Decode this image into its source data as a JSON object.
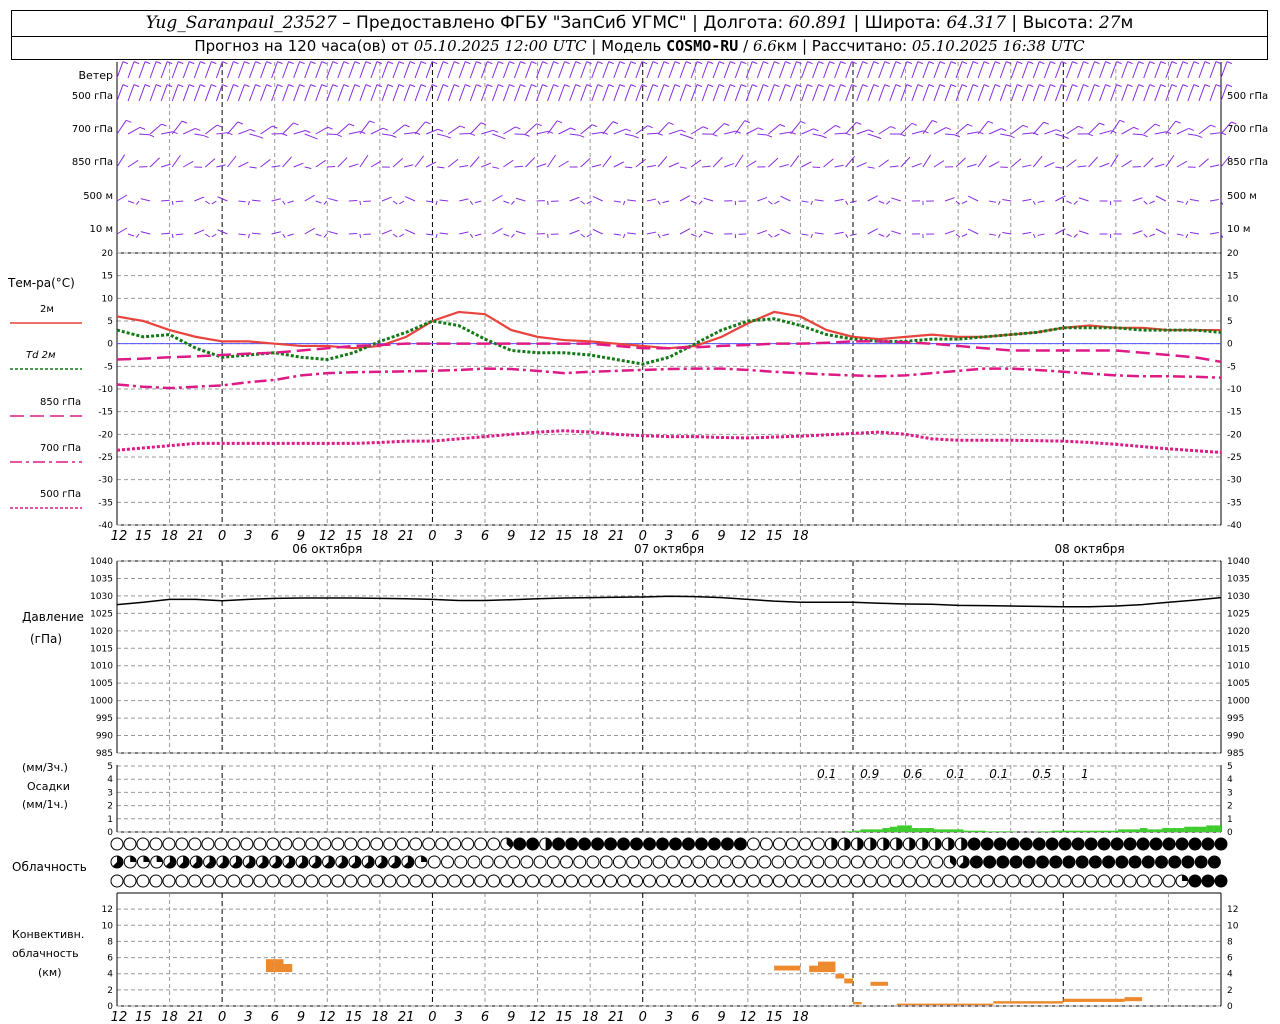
{
  "header": {
    "station": "Yug_Saranpaul_23527",
    "dash": " – ",
    "provider": "Предоставлено ФГБУ \"ЗапСиб УГМС\"",
    "lon_label": "Долгота:",
    "lon": "60.891",
    "lat_label": "Широта:",
    "lat": "64.317",
    "alt_label": "Высота:",
    "alt": "27",
    "alt_unit": "м",
    "forecast_label": "Прогноз на 120 часа(ов) от",
    "forecast_time": "05.10.2025 12:00 UTC",
    "model_label": "Модель",
    "model": "COSMO-RU",
    "model_res": "6.6",
    "model_res_unit": "км",
    "calc_label": "Рассчитано:",
    "calc_time": "05.10.2025 16:38 UTC"
  },
  "chart_data": [
    {
      "id": "wind",
      "type": "other",
      "title": "Ветер",
      "levels": [
        "500 гПа",
        "700 гПа",
        "850 гПа",
        "500 м",
        "10 м"
      ],
      "barb_color": "#8a2be2"
    },
    {
      "id": "temperature",
      "type": "line",
      "ylabel": "Тем-ра(°C)",
      "ylim": [
        -40,
        20
      ],
      "yticks": [
        20,
        15,
        10,
        5,
        0,
        -5,
        -10,
        -15,
        -20,
        -25,
        -30,
        -35,
        -40
      ],
      "x_hours": [
        0,
        3,
        6,
        9,
        12,
        15,
        18,
        21,
        24,
        27,
        30,
        33,
        36,
        39,
        42,
        45,
        48,
        51,
        54,
        57,
        60,
        63,
        66,
        69,
        72,
        75,
        78,
        81,
        84,
        87,
        90,
        93,
        96,
        99,
        102,
        105,
        108,
        111,
        114,
        117,
        120,
        123,
        126
      ],
      "series": [
        {
          "name": "2м",
          "color": "#e8433c",
          "style": "solid",
          "values": [
            6,
            5,
            3,
            1.5,
            0.5,
            0.5,
            0,
            -0.5,
            -0.5,
            -1,
            -0.5,
            1.5,
            5,
            7,
            6.5,
            3,
            1.5,
            0.8,
            0.5,
            0,
            -0.5,
            -1,
            -0.5,
            1.5,
            4.5,
            7,
            6,
            3,
            1.5,
            1,
            1.5,
            2,
            1.5,
            1.5,
            2,
            2.5,
            3.5,
            4,
            3.5,
            3.5,
            3,
            3,
            3
          ]
        },
        {
          "name": "Td 2м",
          "color": "#117a17",
          "style": "dotted",
          "values": [
            3,
            1.5,
            2,
            -1,
            -3,
            -2.5,
            -2,
            -3,
            -3.5,
            -2,
            0.5,
            2.5,
            5,
            4,
            1,
            -1.5,
            -2,
            -2,
            -2.5,
            -3.5,
            -4.5,
            -3,
            0,
            3,
            5,
            5.5,
            4,
            2,
            1,
            0.5,
            0.5,
            1,
            1,
            1.5,
            2,
            2.5,
            3.5,
            3.5,
            3.5,
            3,
            3,
            3,
            2.5
          ]
        },
        {
          "name": "850 гПа",
          "color": "#dd1a86",
          "style": "longdash",
          "values": [
            -3.5,
            -3.3,
            -3,
            -2.8,
            -2.5,
            -2.2,
            -2,
            -1.5,
            -1,
            -0.5,
            -0.3,
            0,
            0,
            0,
            0,
            0,
            0,
            0,
            0,
            -0.5,
            -1,
            -1,
            -0.8,
            -0.5,
            -0.3,
            0,
            0,
            0.2,
            0.5,
            0.5,
            0.3,
            0,
            -0.5,
            -1,
            -1.5,
            -1.5,
            -1.5,
            -1.5,
            -1.5,
            -2,
            -2.5,
            -3,
            -4
          ]
        },
        {
          "name": "700 гПа",
          "color": "#dd1a86",
          "style": "dashdot",
          "values": [
            -9,
            -9.5,
            -9.8,
            -9.5,
            -9.2,
            -8.5,
            -8,
            -7,
            -6.5,
            -6.3,
            -6.2,
            -6.1,
            -6,
            -5.8,
            -5.5,
            -5.6,
            -6,
            -6.5,
            -6.2,
            -6,
            -5.8,
            -5.6,
            -5.5,
            -5.5,
            -5.8,
            -6.2,
            -6.5,
            -6.8,
            -7,
            -7.2,
            -7,
            -6.5,
            -6,
            -5.5,
            -5.5,
            -5.8,
            -6.2,
            -6.6,
            -7,
            -7.2,
            -7.2,
            -7.3,
            -7.5
          ]
        },
        {
          "name": "500 гПа",
          "color": "#dd1a86",
          "style": "dotted",
          "values": [
            -23.5,
            -23,
            -22.5,
            -22,
            -22,
            -22,
            -22,
            -22,
            -22,
            -22,
            -21.8,
            -21.5,
            -21.5,
            -21,
            -20.5,
            -20,
            -19.5,
            -19.2,
            -19.5,
            -20,
            -20.3,
            -20.5,
            -20.5,
            -20.7,
            -20.8,
            -20.6,
            -20.4,
            -20.1,
            -19.8,
            -19.5,
            -20,
            -21,
            -21.3,
            -21.3,
            -21.3,
            -21.4,
            -21.5,
            -21.8,
            -22.2,
            -22.7,
            -23.2,
            -23.6,
            -24
          ]
        }
      ]
    },
    {
      "id": "pressure",
      "type": "line",
      "ylabel": "Давление",
      "yunit": "(гПа)",
      "ylim": [
        985,
        1040
      ],
      "yticks": [
        1040,
        1035,
        1030,
        1025,
        1020,
        1015,
        1010,
        1005,
        1000,
        995,
        990,
        985
      ],
      "x_hours": [
        0,
        3,
        6,
        9,
        12,
        15,
        18,
        21,
        24,
        27,
        30,
        33,
        36,
        39,
        42,
        45,
        48,
        51,
        54,
        57,
        60,
        63,
        66,
        69,
        72,
        75,
        78,
        81,
        84,
        87,
        90,
        93,
        96,
        99,
        102,
        105,
        108,
        111,
        114,
        117,
        120,
        123,
        126
      ],
      "series": [
        {
          "name": "",
          "color": "#000000",
          "values": [
            1027.5,
            1028.2,
            1029,
            1029,
            1028.6,
            1029,
            1029.3,
            1029.4,
            1029.4,
            1029.4,
            1029.3,
            1029.2,
            1029,
            1028.7,
            1028.7,
            1028.9,
            1029.2,
            1029.4,
            1029.5,
            1029.6,
            1029.7,
            1029.9,
            1029.8,
            1029.5,
            1029,
            1028.5,
            1028.2,
            1028.2,
            1028.2,
            1027.9,
            1027.7,
            1027.6,
            1027.3,
            1027.2,
            1027.1,
            1027,
            1026.9,
            1026.9,
            1027.1,
            1027.5,
            1028.2,
            1028.8,
            1029.5
          ]
        }
      ]
    },
    {
      "id": "precipitation",
      "type": "bar",
      "ylabel_top": "(мм/3ч.)",
      "ylabel_mid": "Осадки",
      "ylabel_bot": "(мм/1ч.)",
      "ylim": [
        0,
        5
      ],
      "yticks": [
        5,
        4,
        3,
        2,
        1,
        0
      ],
      "bar_color": "#3fcc2f",
      "hourly": [
        0,
        0,
        0,
        0,
        0,
        0,
        0,
        0,
        0,
        0,
        0,
        0,
        0,
        0,
        0,
        0,
        0,
        0,
        0,
        0,
        0,
        0,
        0,
        0,
        0,
        0,
        0,
        0,
        0,
        0,
        0,
        0,
        0,
        0,
        0,
        0,
        0,
        0,
        0,
        0,
        0,
        0,
        0,
        0,
        0,
        0,
        0,
        0,
        0,
        0,
        0,
        0,
        0,
        0,
        0,
        0,
        0,
        0,
        0,
        0,
        0,
        0,
        0,
        0,
        0,
        0,
        0,
        0,
        0,
        0,
        0,
        0,
        0,
        0,
        0,
        0,
        0,
        0,
        0,
        0,
        0,
        0,
        0,
        0,
        0,
        0,
        0,
        0,
        0,
        0,
        0,
        0,
        0,
        0,
        0,
        0,
        0,
        0,
        0,
        0.05,
        0.1,
        0.2,
        0.2,
        0.2,
        0.3,
        0.4,
        0.5,
        0.5,
        0.3,
        0.3,
        0.3,
        0.2,
        0.2,
        0.2,
        0.2,
        0.1,
        0.1,
        0.1,
        0.05,
        0.05,
        0.05,
        0.05,
        0,
        0,
        0,
        0.05,
        0.05,
        0.1,
        0.1,
        0.1,
        0.1,
        0.1,
        0.1,
        0.1,
        0.1,
        0.1,
        0.2,
        0.2,
        0.2,
        0.3,
        0.2,
        0.2,
        0.3,
        0.3,
        0.3,
        0.4,
        0.4,
        0.4,
        0.5,
        0.5
      ],
      "three_hour_labels": [
        {
          "hour": 99,
          "label": "0.1"
        },
        {
          "hour": 105,
          "label": "0.9"
        },
        {
          "hour": 111,
          "label": "0.6"
        },
        {
          "hour": 117,
          "label": "0.1"
        },
        {
          "hour": 123,
          "label": "0.1"
        },
        {
          "hour": 129,
          "label": "0.5"
        },
        {
          "hour": 135,
          "label": "1"
        }
      ]
    },
    {
      "id": "cloudiness",
      "type": "other",
      "label": "Облачность",
      "rows": [
        "000000000000000100000001000000000100000000000000000000000002346663466666666666666666666666666666600000000000004444444444444444444444666666666666666666666666666666666666666",
        "532525255252525252525252525252525252525252525020000000000000000000000000000000000000000000000000000000000000000000000000000002345666666666666666666666666666666666666666",
        "000000000000000000000000000000000000000000000000000000000000000000000000000000000000000000000000000000000000000000000000000000000000000000000000000000000000000000002366666"
      ]
    },
    {
      "id": "convective",
      "type": "bar",
      "ylabel": "Конвективн.",
      "ylabel2": "облачность",
      "yunit": "(км)",
      "ylim": [
        0,
        14
      ],
      "yticks": [
        12,
        10,
        8,
        6,
        4,
        2,
        0
      ],
      "bar_color": "#ee8a2e",
      "layers": [
        {
          "from_hour": 17,
          "to_hour": 18,
          "bottom": 4.2,
          "top": 5.8
        },
        {
          "from_hour": 18,
          "to_hour": 19,
          "bottom": 4.2,
          "top": 5.8
        },
        {
          "from_hour": 19,
          "to_hour": 20,
          "bottom": 4.2,
          "top": 5.2
        },
        {
          "from_hour": 75,
          "to_hour": 78,
          "bottom": 4.4,
          "top": 5.0
        },
        {
          "from_hour": 79,
          "to_hour": 80,
          "bottom": 4.2,
          "top": 5.0
        },
        {
          "from_hour": 80,
          "to_hour": 82,
          "bottom": 4.2,
          "top": 5.5
        },
        {
          "from_hour": 82,
          "to_hour": 83,
          "bottom": 3.4,
          "top": 4.0
        },
        {
          "from_hour": 83,
          "to_hour": 84,
          "bottom": 2.8,
          "top": 3.4
        },
        {
          "from_hour": 84,
          "to_hour": 85,
          "bottom": 0.2,
          "top": 0.5
        },
        {
          "from_hour": 86,
          "to_hour": 88,
          "bottom": 2.5,
          "top": 3.0
        },
        {
          "from_hour": 89,
          "to_hour": 100,
          "bottom": 0.1,
          "top": 0.3
        },
        {
          "from_hour": 100,
          "to_hour": 108,
          "bottom": 0.3,
          "top": 0.6
        },
        {
          "from_hour": 108,
          "to_hour": 115,
          "bottom": 0.5,
          "top": 0.9
        },
        {
          "from_hour": 115,
          "to_hour": 117,
          "bottom": 0.6,
          "top": 1.1
        }
      ]
    }
  ],
  "time_axis": {
    "tick_labels": [
      "12",
      "15",
      "18",
      "21",
      "0",
      "3",
      "6",
      "9",
      "12",
      "15",
      "18",
      "21",
      "0",
      "3",
      "6",
      "9",
      "12",
      "15",
      "18",
      "21",
      "0",
      "3",
      "6",
      "9",
      "12",
      "15",
      "18"
    ],
    "day_labels": [
      "06 октября",
      "07 октября",
      "08 октября"
    ]
  }
}
